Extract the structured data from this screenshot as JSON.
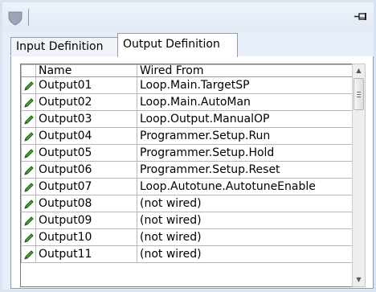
{
  "toolbar": {
    "pin_icon": "pin-icon",
    "shield_icon": "shield-icon"
  },
  "tabs": [
    {
      "label": "Input Definition",
      "selected": false
    },
    {
      "label": "Output Definition",
      "selected": true
    }
  ],
  "table": {
    "columns": [
      "",
      "Name",
      "Wired From"
    ],
    "rows": [
      {
        "name": "Output01",
        "wired_from": "Loop.Main.TargetSP"
      },
      {
        "name": "Output02",
        "wired_from": "Loop.Main.AutoMan"
      },
      {
        "name": "Output03",
        "wired_from": "Loop.Output.ManualOP"
      },
      {
        "name": "Output04",
        "wired_from": "Programmer.Setup.Run"
      },
      {
        "name": "Output05",
        "wired_from": "Programmer.Setup.Hold"
      },
      {
        "name": "Output06",
        "wired_from": "Programmer.Setup.Reset"
      },
      {
        "name": "Output07",
        "wired_from": "Loop.Autotune.AutotuneEnable"
      },
      {
        "name": "Output08",
        "wired_from": "(not wired)"
      },
      {
        "name": "Output09",
        "wired_from": "(not wired)"
      },
      {
        "name": "Output10",
        "wired_from": "(not wired)"
      },
      {
        "name": "Output11",
        "wired_from": "(not wired)"
      }
    ],
    "row_icon": "pencil-icon"
  },
  "colors": {
    "panel_bg": "#e8eef7",
    "border": "#8f9db1",
    "pencil_green": "#3f9d2a"
  }
}
